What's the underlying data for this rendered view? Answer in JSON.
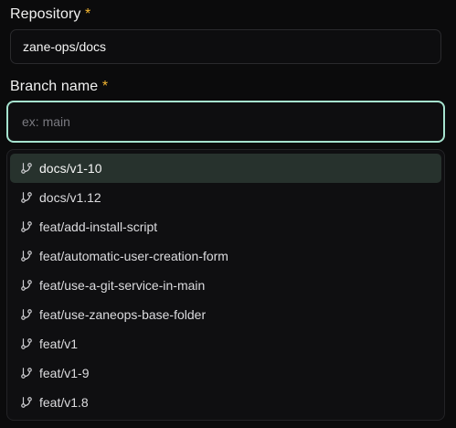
{
  "repository": {
    "label": "Repository",
    "required_mark": "*",
    "value": "zane-ops/docs"
  },
  "branch": {
    "label": "Branch name",
    "required_mark": "*",
    "placeholder": "ex: main",
    "value": ""
  },
  "options": [
    {
      "label": "docs/v1-10",
      "icon": "git-branch-icon",
      "active": true
    },
    {
      "label": "docs/v1.12",
      "icon": "git-branch-icon"
    },
    {
      "label": "feat/add-install-script",
      "icon": "git-branch-icon"
    },
    {
      "label": "feat/automatic-user-creation-form",
      "icon": "git-branch-icon"
    },
    {
      "label": "feat/use-a-git-service-in-main",
      "icon": "git-branch-icon"
    },
    {
      "label": "feat/use-zaneops-base-folder",
      "icon": "git-branch-icon"
    },
    {
      "label": "feat/v1",
      "icon": "git-branch-icon"
    },
    {
      "label": "feat/v1-9",
      "icon": "git-branch-icon"
    },
    {
      "label": "feat/v1.8",
      "icon": "git-branch-icon"
    }
  ],
  "colors": {
    "focus_ring": "#a6e3cf",
    "required": "#f5b731",
    "active_option_bg": "#27322d"
  }
}
